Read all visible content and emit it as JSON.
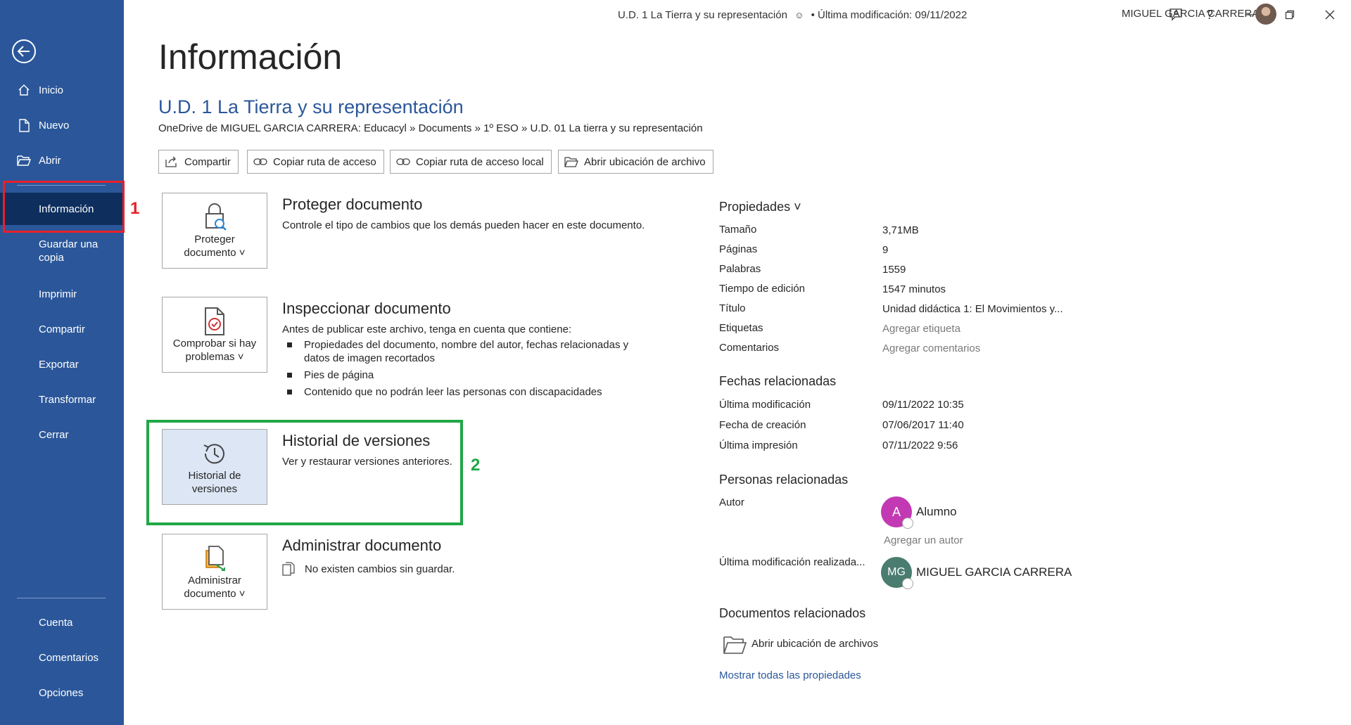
{
  "window": {
    "doc_title": "U.D. 1 La Tierra y su representación",
    "modified": "• Última modificación: 09/11/2022",
    "user": "MIGUEL GARCIA CARRERA",
    "buttons": [
      "people-icon",
      "feedback-icon",
      "help-icon",
      "minimize-icon",
      "restore-icon",
      "close-icon"
    ]
  },
  "sidebar": {
    "back_icon": "back-arrow-icon",
    "items": [
      {
        "label": "Inicio",
        "icon": "home-icon"
      },
      {
        "label": "Nuevo",
        "icon": "new-doc-icon"
      },
      {
        "label": "Abrir",
        "icon": "folder-icon"
      },
      {
        "label": "Información",
        "active": true
      },
      {
        "label": "Guardar una copia"
      },
      {
        "label": "Imprimir"
      },
      {
        "label": "Compartir"
      },
      {
        "label": "Exportar"
      },
      {
        "label": "Transformar"
      },
      {
        "label": "Cerrar"
      }
    ],
    "bottom": [
      {
        "label": "Cuenta"
      },
      {
        "label": "Comentarios"
      },
      {
        "label": "Opciones"
      }
    ]
  },
  "annotations": {
    "one": "1",
    "two": "2",
    "red": "#e8202a",
    "green": "#21a745"
  },
  "main": {
    "title": "Información",
    "doc_title": "U.D. 1 La Tierra y su representación",
    "path": "OneDrive de MIGUEL GARCIA CARRERA: Educacyl » Documents » 1º ESO » U.D. 01 La tierra y su representación",
    "actions": [
      "Compartir",
      "Copiar ruta de acceso",
      "Copiar ruta de acceso local",
      "Abrir ubicación de archivo"
    ],
    "sections": {
      "protect": {
        "card": "Proteger documento ˅",
        "card_line1": "Proteger",
        "card_line2": "documento ˅",
        "heading": "Proteger documento",
        "desc": "Controle el tipo de cambios que los demás pueden hacer en este documento."
      },
      "inspect": {
        "card_line1": "Comprobar si hay",
        "card_line2": "problemas ˅",
        "heading": "Inspeccionar documento",
        "desc": "Antes de publicar este archivo, tenga en cuenta que contiene:",
        "bullets": [
          "Propiedades del documento, nombre del autor, fechas relacionadas y datos de imagen recortados",
          "Pies de página",
          "Contenido que no podrán leer las personas con discapacidades"
        ]
      },
      "history": {
        "card_line1": "Historial de",
        "card_line2": "versiones",
        "heading": "Historial de versiones",
        "desc": "Ver y restaurar versiones anteriores."
      },
      "manage": {
        "card_line1": "Administrar",
        "card_line2": "documento ˅",
        "heading": "Administrar documento",
        "desc": "No existen cambios sin guardar."
      }
    }
  },
  "properties": {
    "heading": "Propiedades ˅",
    "rows": [
      {
        "key": "Tamaño",
        "value": "3,71MB"
      },
      {
        "key": "Páginas",
        "value": "9"
      },
      {
        "key": "Palabras",
        "value": "1559"
      },
      {
        "key": "Tiempo de edición",
        "value": "1547 minutos"
      },
      {
        "key": "Título",
        "value": "Unidad didáctica 1: El Movimientos y..."
      },
      {
        "key": "Etiquetas",
        "value": "Agregar etiqueta"
      },
      {
        "key": "Comentarios",
        "value": "Agregar comentarios"
      }
    ],
    "dates_heading": "Fechas relacionadas",
    "dates": [
      {
        "key": "Última modificación",
        "value": "09/11/2022 10:35"
      },
      {
        "key": "Fecha de creación",
        "value": "07/06/2017 11:40"
      },
      {
        "key": "Última impresión",
        "value": "07/11/2022 9:56"
      }
    ],
    "people_heading": "Personas relacionadas",
    "author_key": "Autor",
    "author": {
      "initials": "A",
      "name": "Alumno",
      "color": "#c239b3"
    },
    "add_author": "Agregar un autor",
    "last_mod_key": "Última modificación realizada...",
    "last_mod": {
      "initials": "MG",
      "name": "MIGUEL GARCIA CARRERA",
      "color": "#4a7c6f"
    },
    "docs_heading": "Documentos relacionados",
    "open_location": "Abrir ubicación de archivos",
    "show_all": "Mostrar todas las propiedades"
  }
}
